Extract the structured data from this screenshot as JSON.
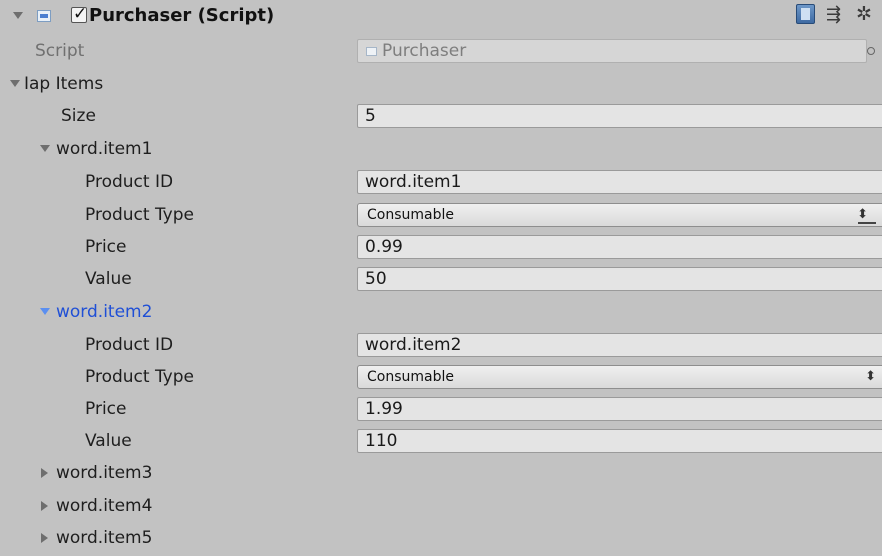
{
  "component": {
    "title": "Purchaser (Script)",
    "enabled": true,
    "icons": [
      "collapse-arrow-icon",
      "script-icon",
      "checkbox-icon",
      "help-book-icon",
      "preset-sliders-icon",
      "gear-icon"
    ]
  },
  "script_field": {
    "label": "Script",
    "value": "Purchaser"
  },
  "iap_items": {
    "label": "Iap Items",
    "size_label": "Size",
    "size_value": "5",
    "items": [
      {
        "name": "word.item1",
        "expanded": true,
        "product_id_label": "Product ID",
        "product_id": "word.item1",
        "product_type_label": "Product Type",
        "product_type": "Consumable",
        "price_label": "Price",
        "price": "0.99",
        "value_label": "Value",
        "value": "50"
      },
      {
        "name": "word.item2",
        "expanded": true,
        "selected": true,
        "product_id_label": "Product ID",
        "product_id": "word.item2",
        "product_type_label": "Product Type",
        "product_type": "Consumable",
        "price_label": "Price",
        "price": "1.99",
        "value_label": "Value",
        "value": "110"
      },
      {
        "name": "word.item3",
        "expanded": false
      },
      {
        "name": "word.item4",
        "expanded": false
      },
      {
        "name": "word.item5",
        "expanded": false
      }
    ]
  },
  "colors": {
    "background": "#c2c2c2",
    "field_background": "#e4e4e4",
    "selected_text": "#1f4fd6"
  }
}
